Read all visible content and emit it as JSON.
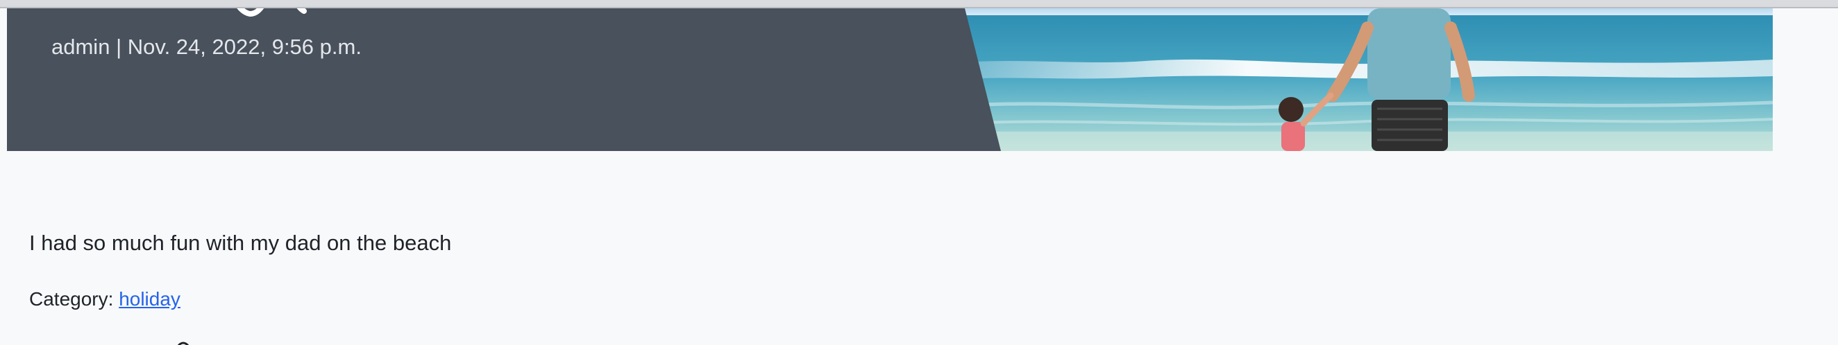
{
  "post": {
    "author": "admin",
    "separator": "|",
    "date": "Nov. 24, 2022, 9:56 p.m.",
    "body": "I had so much fun with my dad on the beach",
    "category_label": "Category:",
    "category_link": "holiday"
  },
  "colors": {
    "panel": "#48515c",
    "link": "#2563eb",
    "background": "#f8f9fb"
  }
}
